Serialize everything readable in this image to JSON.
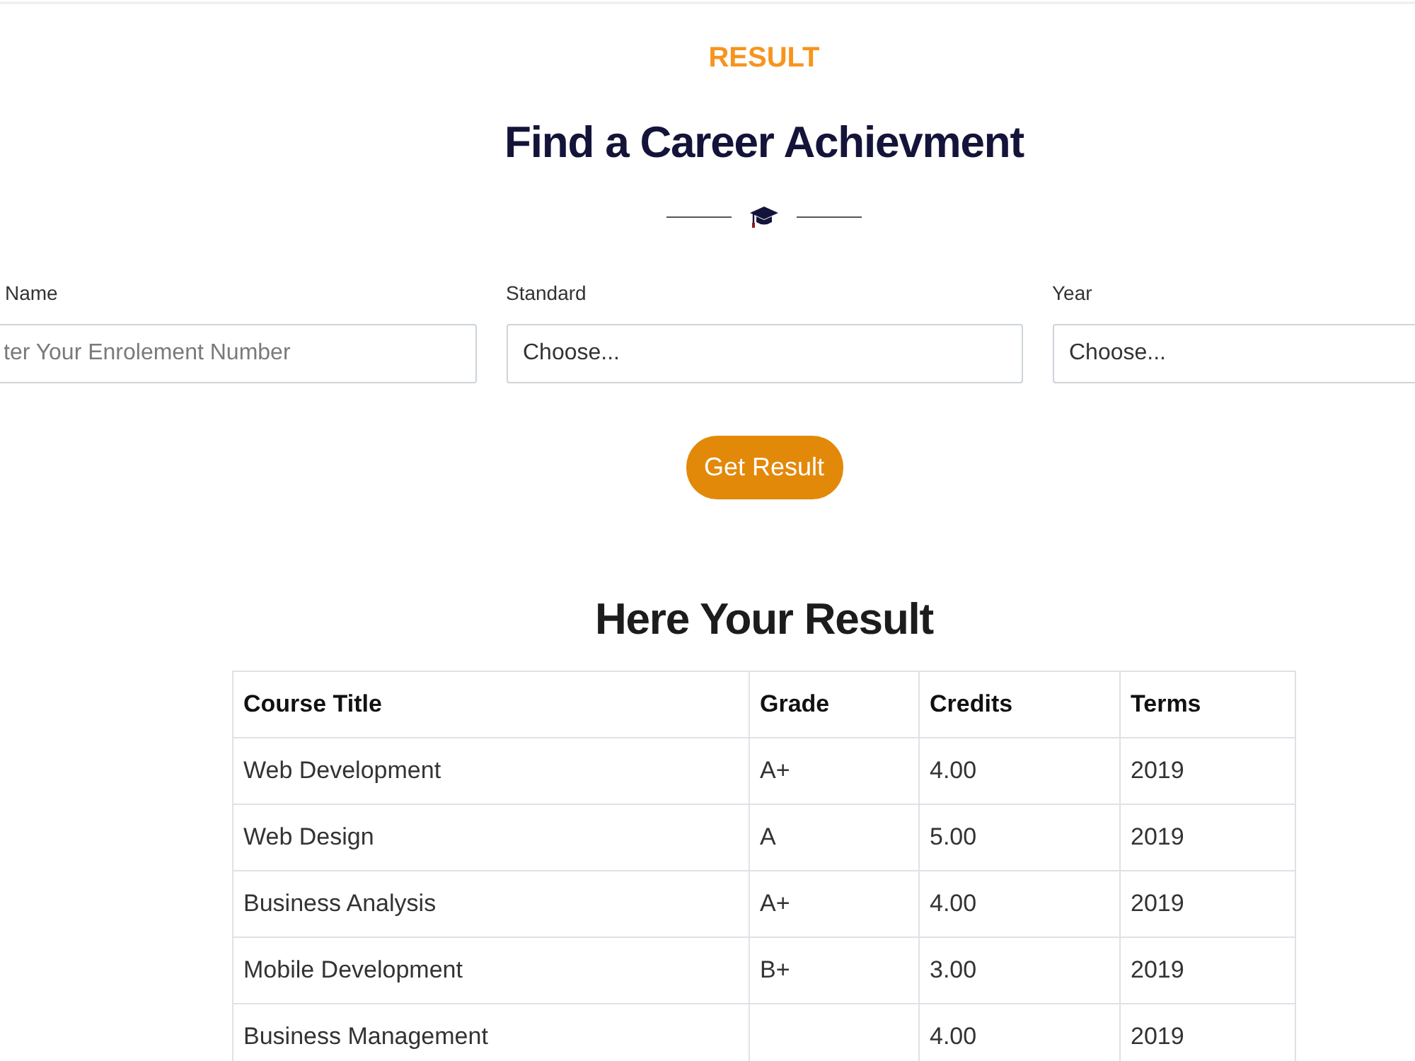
{
  "section_label": "RESULT",
  "title": "Find a Career Achievment",
  "form": {
    "fields": [
      {
        "kind": "text",
        "label": "Name",
        "placeholder": "ter Your Enrolement Number"
      },
      {
        "kind": "select",
        "label": "Standard",
        "value": "Choose..."
      },
      {
        "kind": "select",
        "label": "Year",
        "value": "Choose..."
      }
    ],
    "submit": "Get Result"
  },
  "result": {
    "title": "Here Your Result",
    "table": {
      "columns": [
        "Course Title",
        "Grade",
        "Credits",
        "Terms"
      ],
      "rows": [
        {
          "course_title": "Web Development",
          "grade": "A+",
          "credits": "4.00",
          "terms": "2019"
        },
        {
          "course_title": "Web Design",
          "grade": "A",
          "credits": "5.00",
          "terms": "2019"
        },
        {
          "course_title": "Business Analysis",
          "grade": "A+",
          "credits": "4.00",
          "terms": "2019"
        },
        {
          "course_title": "Mobile Development",
          "grade": "B+",
          "credits": "3.00",
          "terms": "2019"
        },
        {
          "course_title": "Business Management",
          "credits": "4.00",
          "terms": "2019"
        }
      ]
    }
  }
}
